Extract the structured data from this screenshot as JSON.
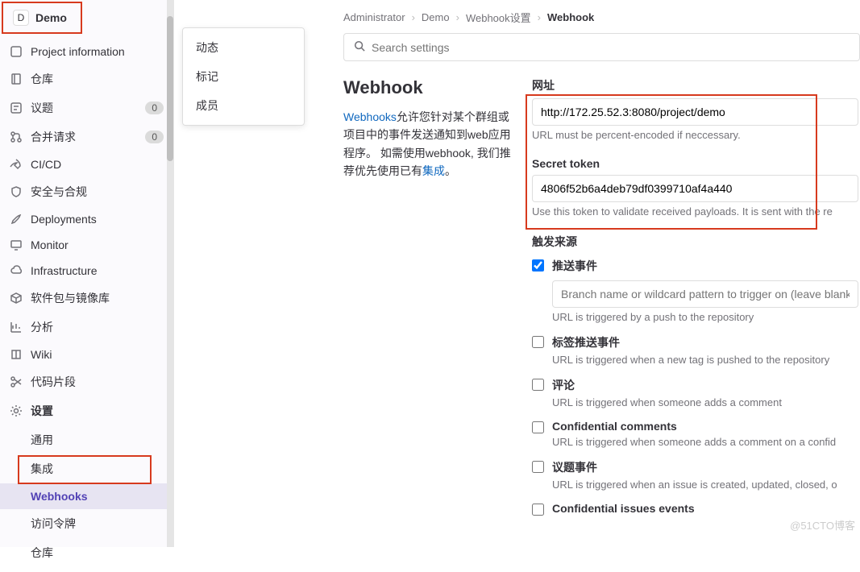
{
  "project": {
    "avatar_letter": "D",
    "name": "Demo"
  },
  "sidebar": {
    "items": [
      {
        "label": "Project information",
        "badge": null
      },
      {
        "label": "仓库",
        "badge": null
      },
      {
        "label": "议题",
        "badge": "0"
      },
      {
        "label": "合并请求",
        "badge": "0"
      },
      {
        "label": "CI/CD",
        "badge": null
      },
      {
        "label": "安全与合规",
        "badge": null
      },
      {
        "label": "Deployments",
        "badge": null
      },
      {
        "label": "Monitor",
        "badge": null
      },
      {
        "label": "Infrastructure",
        "badge": null
      },
      {
        "label": "软件包与镜像库",
        "badge": null
      },
      {
        "label": "分析",
        "badge": null
      },
      {
        "label": "Wiki",
        "badge": null
      },
      {
        "label": "代码片段",
        "badge": null
      },
      {
        "label": "设置",
        "badge": null
      }
    ],
    "settings_sub": [
      {
        "label": "通用"
      },
      {
        "label": "集成"
      },
      {
        "label": "Webhooks"
      },
      {
        "label": "访问令牌"
      },
      {
        "label": "仓库"
      }
    ]
  },
  "flyout": {
    "items": [
      "动态",
      "标记",
      "成员"
    ]
  },
  "breadcrumbs": [
    "Administrator",
    "Demo",
    "Webhook设置",
    "Webhook"
  ],
  "search": {
    "placeholder": "Search settings"
  },
  "webhook": {
    "title": "Webhook",
    "desc_link": "Webhooks",
    "desc1": "允许您针对某个群组或项目中的事件发送通知到web应用程序。  如需使用webhook, 我们推荐优先使用已有",
    "desc_link2": "集成",
    "desc2": "。",
    "url_label": "网址",
    "url_value": "http://172.25.52.3:8080/project/demo",
    "url_hint": "URL must be percent-encoded if neccessary.",
    "token_label": "Secret token",
    "token_value": "4806f52b6a4deb79df0399710af4a440",
    "token_hint": "Use this token to validate received payloads. It is sent with the re",
    "trigger_title": "触发来源",
    "triggers": [
      {
        "name": "推送事件",
        "checked": true,
        "has_branch": true,
        "branch_placeholder": "Branch name or wildcard pattern to trigger on (leave blank",
        "hint": "URL is triggered by a push to the repository"
      },
      {
        "name": "标签推送事件",
        "checked": false,
        "hint": "URL is triggered when a new tag is pushed to the repository"
      },
      {
        "name": "评论",
        "checked": false,
        "hint": "URL is triggered when someone adds a comment"
      },
      {
        "name": "Confidential comments",
        "checked": false,
        "hint": "URL is triggered when someone adds a comment on a confid"
      },
      {
        "name": "议题事件",
        "checked": false,
        "hint": "URL is triggered when an issue is created, updated, closed, o"
      },
      {
        "name": "Confidential issues events",
        "checked": false,
        "hint": ""
      }
    ]
  },
  "watermark": "@51CTO博客"
}
